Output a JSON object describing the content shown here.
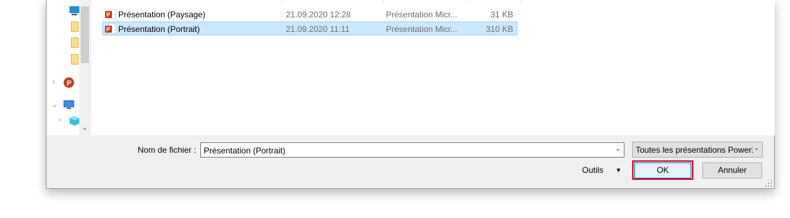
{
  "files": [
    {
      "name": "Présentation (Paysage)",
      "date": "21.09.2020 12:28",
      "type": "Présentation Micr...",
      "size": "31 KB",
      "icon": "powerpoint-file-icon"
    },
    {
      "name": "Présentation (Portrait)",
      "date": "21.09.2020 11:11",
      "type": "Présentation Micr...",
      "size": "310 KB",
      "icon": "powerpoint-file-icon",
      "selected": true
    }
  ],
  "filename": {
    "label": "Nom de fichier :",
    "value": "Présentation (Portrait)"
  },
  "filetype": {
    "value": "Toutes les présentations PowerP"
  },
  "tools_label": "Outils",
  "ok_label": "OK",
  "cancel_label": "Annuler",
  "colors": {
    "selection": "#cce8ff",
    "selection_border": "#99d1ff",
    "highlight": "#e2001a",
    "powerpoint": "#c43e1c",
    "ok_border": "#0078d7"
  },
  "nav_icons": [
    "desktop-icon",
    "folder-icon",
    "folder-icon",
    "folder-icon",
    "powerpoint-icon",
    "computer-icon",
    "3d-objects-icon",
    "drive-icon"
  ]
}
